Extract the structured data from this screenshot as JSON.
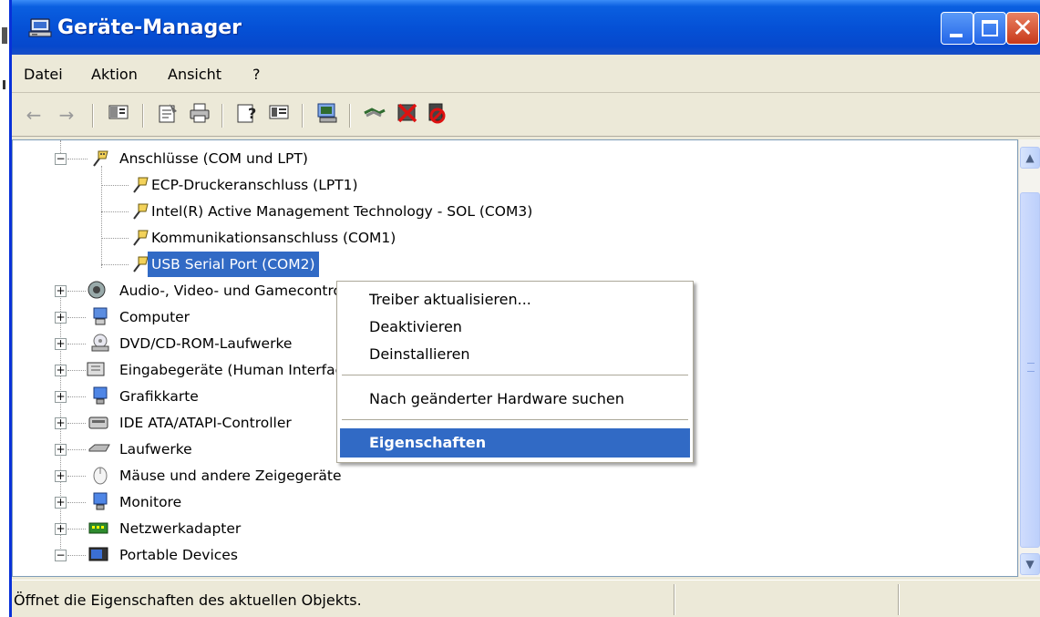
{
  "window": {
    "title": "Geräte-Manager",
    "close_glyph": "✕"
  },
  "menubar": {
    "items": [
      "Datei",
      "Aktion",
      "Ansicht",
      "?"
    ]
  },
  "toolbar": {
    "buttons": [
      "back-arrow-icon",
      "forward-arrow-icon",
      "show-hide-tree-icon",
      "properties-icon",
      "print-icon",
      "help-icon",
      "view-icon",
      "scan-hardware-icon",
      "update-driver-icon",
      "uninstall-icon",
      "disable-icon"
    ]
  },
  "tree": {
    "ports_group": "Anschlüsse (COM und LPT)",
    "ports": [
      "ECP-Druckeranschluss (LPT1)",
      "Intel(R) Active Management Technology - SOL (COM3)",
      "Kommunikationsanschluss (COM1)",
      "USB Serial Port (COM2)"
    ],
    "categories": [
      "Audio-, Video- und Gamecontroller",
      "Computer",
      "DVD/CD-ROM-Laufwerke",
      "Eingabegeräte (Human Interface Devices)",
      "Grafikkarte",
      "IDE ATA/ATAPI-Controller",
      "Laufwerke",
      "Mäuse und andere Zeigegeräte",
      "Monitore",
      "Netzwerkadapter",
      "Portable Devices"
    ]
  },
  "context_menu": {
    "items": [
      "Treiber aktualisieren...",
      "Deaktivieren",
      "Deinstallieren",
      "Nach geänderter Hardware suchen",
      "Eigenschaften"
    ],
    "highlighted": "Eigenschaften"
  },
  "statusbar": {
    "text": "Öffnet die Eigenschaften des aktuellen Objekts."
  },
  "colors": {
    "titlebar": "#0551d6",
    "selection": "#316ac5",
    "chrome": "#ece9d8"
  }
}
